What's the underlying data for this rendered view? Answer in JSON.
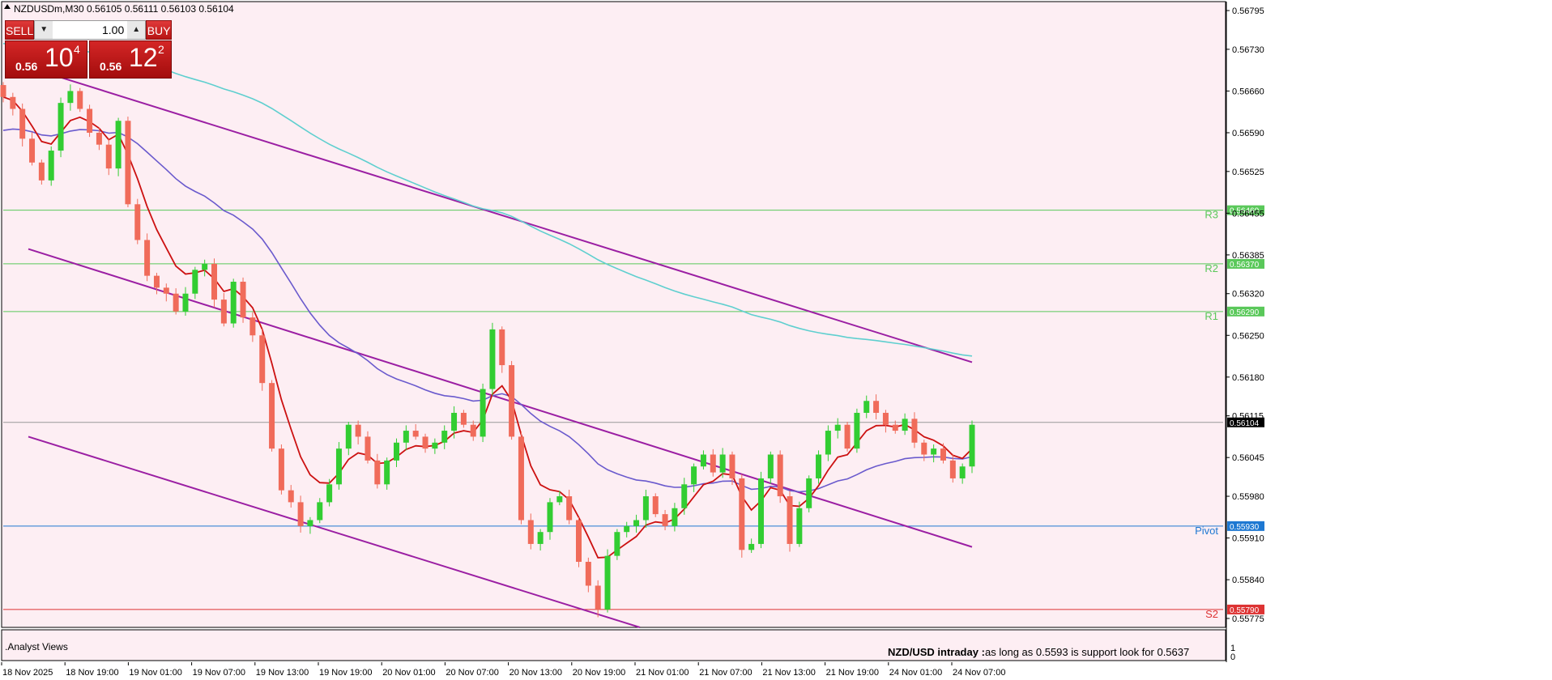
{
  "header": {
    "symbol_info": "NZDUSDm,M30  0.56105 0.56111 0.56103 0.56104"
  },
  "trade_panel": {
    "sell_label": "SELL",
    "buy_label": "BUY",
    "lot_value": "1.00",
    "sell_quote": {
      "small": "0.56",
      "big": "10",
      "sup": "4"
    },
    "buy_quote": {
      "small": "0.56",
      "big": "12",
      "sup": "2"
    }
  },
  "indicator_window": {
    "label": ".Analyst Views",
    "scale_top": "1",
    "scale_bottom": "0"
  },
  "annotation": {
    "title": "NZD/USD intraday :",
    "text": "as long as 0.5593 is support look for 0.5637"
  },
  "colors": {
    "background": "#fdeef3",
    "bull": "#32cd32",
    "bear": "#f06b5a",
    "ma_fast": "#cc1111",
    "ma_mid": "#6a5acd",
    "ma_slow": "#5fcfcf",
    "channel": "#9b1fa3",
    "resistance": "#5ac85a",
    "pivot": "#1e78d2",
    "support": "#dd3333",
    "current_price": "#000000"
  },
  "chart_data": {
    "type": "candlestick",
    "symbol": "NZDUSDm",
    "timeframe": "M30",
    "ylim": [
      0.5576,
      0.5681
    ],
    "y_ticks": [
      "0.56795",
      "0.56730",
      "0.56660",
      "0.56590",
      "0.56525",
      "0.56455",
      "0.56385",
      "0.56320",
      "0.56250",
      "0.56180",
      "0.56115",
      "0.56045",
      "0.55980",
      "0.55910",
      "0.55840",
      "0.55775"
    ],
    "x_ticks": [
      "18 Nov 2025",
      "18 Nov 19:00",
      "19 Nov 01:00",
      "19 Nov 07:00",
      "19 Nov 13:00",
      "19 Nov 19:00",
      "20 Nov 01:00",
      "20 Nov 07:00",
      "20 Nov 13:00",
      "20 Nov 19:00",
      "21 Nov 01:00",
      "21 Nov 07:00",
      "21 Nov 13:00",
      "21 Nov 19:00",
      "24 Nov 01:00",
      "24 Nov 07:00"
    ],
    "current_price": "0.56104",
    "levels": [
      {
        "name": "R3",
        "value": 0.5646,
        "label": "0.56460",
        "color": "#5ac85a"
      },
      {
        "name": "R2",
        "value": 0.5637,
        "label": "0.56370",
        "color": "#5ac85a"
      },
      {
        "name": "R1",
        "value": 0.5629,
        "label": "0.56290",
        "color": "#5ac85a"
      },
      {
        "name": "Pivot",
        "value": 0.5593,
        "label": "0.55930",
        "color": "#1e78d2"
      },
      {
        "name": "S2",
        "value": 0.5579,
        "label": "0.55790",
        "color": "#dd3333"
      }
    ],
    "closes": [
      0.5665,
      0.5663,
      0.5658,
      0.5654,
      0.5651,
      0.5656,
      0.5664,
      0.5666,
      0.5663,
      0.5659,
      0.5657,
      0.5653,
      0.5661,
      0.5647,
      0.5641,
      0.5635,
      0.5633,
      0.5632,
      0.5629,
      0.5632,
      0.5636,
      0.5637,
      0.5631,
      0.5627,
      0.5634,
      0.5628,
      0.5625,
      0.5617,
      0.5606,
      0.5599,
      0.5597,
      0.5593,
      0.5594,
      0.5597,
      0.56,
      0.5606,
      0.561,
      0.5608,
      0.5604,
      0.56,
      0.5604,
      0.5607,
      0.5609,
      0.5608,
      0.5606,
      0.5607,
      0.5609,
      0.5612,
      0.561,
      0.5608,
      0.5616,
      0.5626,
      0.562,
      0.5608,
      0.5594,
      0.559,
      0.5592,
      0.5597,
      0.5598,
      0.5594,
      0.5587,
      0.5583,
      0.5579,
      0.5588,
      0.5592,
      0.5593,
      0.5594,
      0.5598,
      0.5595,
      0.5593,
      0.5596,
      0.56,
      0.5603,
      0.5605,
      0.5602,
      0.5605,
      0.5601,
      0.5589,
      0.559,
      0.5601,
      0.5605,
      0.5598,
      0.559,
      0.5596,
      0.5601,
      0.5605,
      0.5609,
      0.561,
      0.5606,
      0.5612,
      0.5614,
      0.5612,
      0.561,
      0.5609,
      0.5611,
      0.5607,
      0.5605,
      0.5606,
      0.5604,
      0.5601,
      0.5603,
      0.561
    ]
  }
}
